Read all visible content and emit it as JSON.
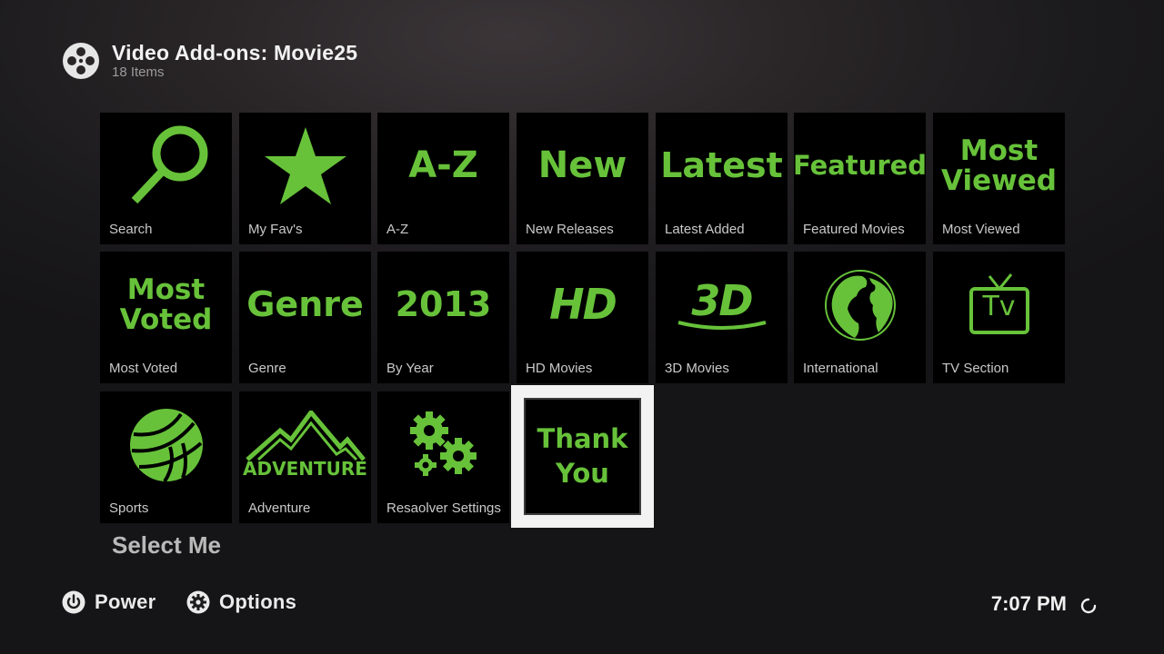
{
  "header": {
    "title": "Video Add-ons: Movie25",
    "subtitle": "18 Items",
    "icon": "film-reel-icon"
  },
  "accent_color": "#67c23a",
  "tiles": [
    {
      "label": "Search",
      "art_icon": "magnifier-icon"
    },
    {
      "label": "My Fav's",
      "art_icon": "star-icon"
    },
    {
      "label": "A-Z",
      "art_text": "A-Z"
    },
    {
      "label": "New Releases",
      "art_text": "New"
    },
    {
      "label": "Latest Added",
      "art_text": "Latest"
    },
    {
      "label": "Featured Movies",
      "art_text": "Featured"
    },
    {
      "label": "Most Viewed",
      "art_line1": "Most",
      "art_line2": "Viewed"
    },
    {
      "label": "Most Voted",
      "art_line1": "Most",
      "art_line2": "Voted"
    },
    {
      "label": "Genre",
      "art_text": "Genre"
    },
    {
      "label": "By Year",
      "art_text": "2013"
    },
    {
      "label": "HD Movies",
      "art_text": "HD"
    },
    {
      "label": "3D Movies",
      "art_text": "3D"
    },
    {
      "label": "International",
      "art_icon": "globe-icon"
    },
    {
      "label": "TV Section",
      "art_icon": "tv-icon",
      "art_text": "Tv"
    },
    {
      "label": "Sports",
      "art_icon": "volleyball-icon"
    },
    {
      "label": "Adventure",
      "art_icon": "mountain-icon",
      "art_text": "ADVENTURE"
    },
    {
      "label": "Resaolver Settings",
      "art_icon": "gears-icon"
    },
    {
      "label": "Select Me",
      "art_line1": "Thank",
      "art_line2": "You",
      "focused": true
    }
  ],
  "focused_label": "Select Me",
  "footer": {
    "power_label": "Power",
    "options_label": "Options",
    "clock": "7:07 PM"
  }
}
